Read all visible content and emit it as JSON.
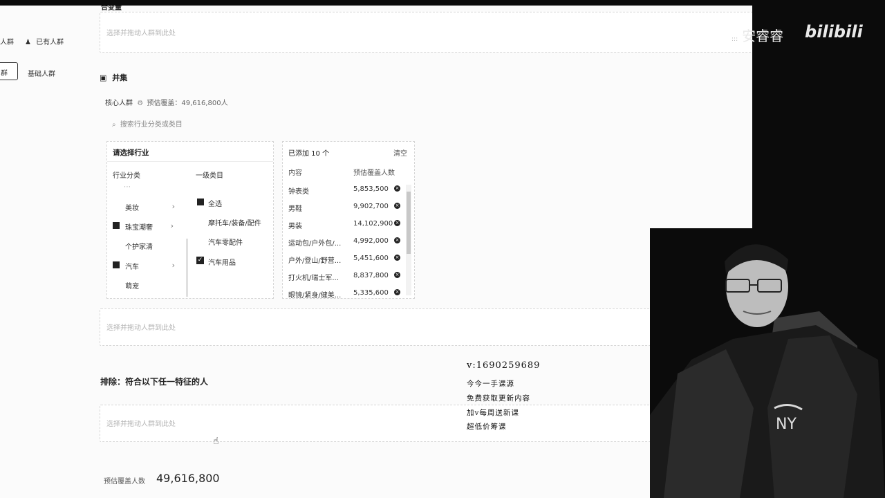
{
  "sidebar": {
    "nav_partial": "人群",
    "existing_crowd": "已有人群",
    "tab_partial": "群",
    "basic_crowd": "基础人群"
  },
  "top_section": {
    "title_partial": "合变量",
    "dropzone_text": "选择并拖动人群到此处"
  },
  "union": {
    "title": "并集",
    "core_label": "核心人群",
    "estimate_text": "预估覆盖：49,616,800人",
    "search_placeholder": "搜索行业分类或类目",
    "picker_title": "请选择行业",
    "col_category": "行业分类",
    "col_level1": "一级类目",
    "categories": [
      {
        "label": "美妆"
      },
      {
        "label": "珠宝潮奢"
      },
      {
        "label": "个护家清"
      },
      {
        "label": "汽车"
      },
      {
        "label": "萌宠"
      }
    ],
    "level1_items": [
      {
        "label": "全选"
      },
      {
        "label": "摩托车/装备/配件"
      },
      {
        "label": "汽车零配件"
      },
      {
        "label": "汽车用品"
      }
    ],
    "added_title": "已添加 10 个",
    "clear_label": "清空",
    "col_content": "内容",
    "col_count": "预估覆盖人数",
    "added_rows": [
      {
        "name": "钟表类",
        "count": "5,853,500"
      },
      {
        "name": "男鞋",
        "count": "9,902,700"
      },
      {
        "name": "男装",
        "count": "14,102,900"
      },
      {
        "name": "运动包/户外包/...",
        "count": "4,992,000"
      },
      {
        "name": "户外/登山/野营...",
        "count": "5,451,600"
      },
      {
        "name": "打火机/瑞士军...",
        "count": "8,837,800"
      },
      {
        "name": "眼镜/紧身/健美...",
        "count": "5,335,600"
      }
    ],
    "dropzone_text": "选择并拖动人群到此处"
  },
  "exclude": {
    "title": "排除：符合以下任一特征的人",
    "dropzone_text": "选择并拖动人群到此处"
  },
  "footer": {
    "estimate_label": "预估覆盖人数",
    "estimate_value": "49,616,800"
  },
  "watermark": {
    "line1": "v:1690259689",
    "line2": "今今一手课源",
    "line3": "免费获取更新内容",
    "line4": "加v每周送新课",
    "line5": "超低价筹课"
  },
  "branding": {
    "uploader": "安睿睿",
    "site": "bilibili"
  },
  "colors": {
    "panel_bg": "#fbfbfb",
    "outer_bg": "#0b0b0b",
    "accent": "#222222"
  }
}
